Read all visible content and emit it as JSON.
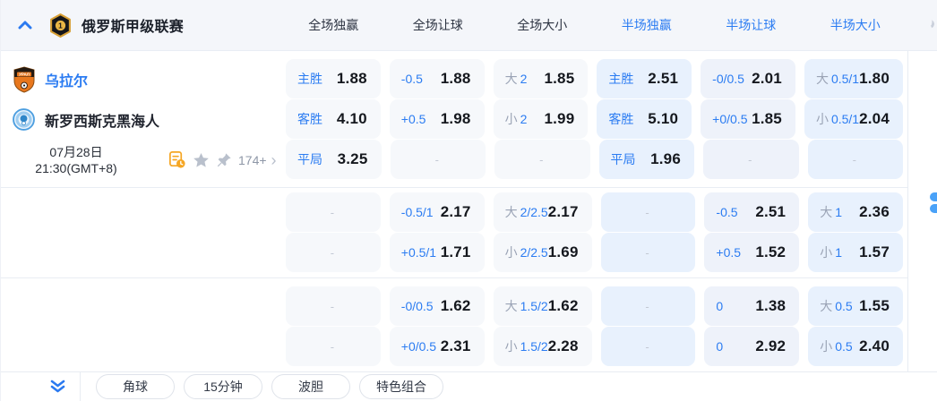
{
  "colors": {
    "accent": "#2b7cf2",
    "half_cell_bg": "#e8f1fd",
    "full_cell_bg": "#f6f8fb",
    "odds_text": "#15181e"
  },
  "header": {
    "league_title": "俄罗斯甲级联赛",
    "columns": [
      {
        "label": "全场独赢",
        "half": false
      },
      {
        "label": "全场让球",
        "half": false
      },
      {
        "label": "全场大小",
        "half": false
      },
      {
        "label": "半场独赢",
        "half": true
      },
      {
        "label": "半场让球",
        "half": true
      },
      {
        "label": "半场大小",
        "half": true
      }
    ]
  },
  "match": {
    "home_team": "乌拉尔",
    "away_team": "新罗西斯克黑海人",
    "date_line1": "07月28日",
    "date_line2": "21:30(GMT+8)",
    "markets_count": "174+",
    "more_arrow": "›"
  },
  "dash_char": "-",
  "sections": [
    {
      "rows": [
        {
          "cells": [
            {
              "label": "主胜",
              "value": "1.88"
            },
            {
              "label": "-0.5",
              "value": "1.88"
            },
            {
              "prefix": "大",
              "label": "2",
              "value": "1.85"
            },
            {
              "label": "主胜",
              "value": "2.51",
              "half": true
            },
            {
              "label": "-0/0.5",
              "value": "2.01",
              "half": true
            },
            {
              "prefix": "大",
              "label": "0.5/1",
              "value": "1.80",
              "half": true
            }
          ]
        },
        {
          "cells": [
            {
              "label": "客胜",
              "value": "4.10"
            },
            {
              "label": "+0.5",
              "value": "1.98"
            },
            {
              "prefix": "小",
              "label": "2",
              "value": "1.99"
            },
            {
              "label": "客胜",
              "value": "5.10",
              "half": true
            },
            {
              "label": "+0/0.5",
              "value": "1.85",
              "half": true
            },
            {
              "prefix": "小",
              "label": "0.5/1",
              "value": "2.04",
              "half": true
            }
          ]
        },
        {
          "cells": [
            {
              "label": "平局",
              "value": "3.25"
            },
            {
              "dash": true
            },
            {
              "dash": true
            },
            {
              "label": "平局",
              "value": "1.96",
              "half": true
            },
            {
              "dash": true,
              "half": true
            },
            {
              "dash": true,
              "half": true
            }
          ]
        }
      ]
    },
    {
      "rows": [
        {
          "cells": [
            {
              "dash": true
            },
            {
              "label": "-0.5/1",
              "value": "2.17"
            },
            {
              "prefix": "大",
              "label": "2/2.5",
              "value": "2.17"
            },
            {
              "dash": true,
              "half": true
            },
            {
              "label": "-0.5",
              "value": "2.51",
              "half": true
            },
            {
              "prefix": "大",
              "label": "1",
              "value": "2.36",
              "half": true
            }
          ]
        },
        {
          "cells": [
            {
              "dash": true
            },
            {
              "label": "+0.5/1",
              "value": "1.71"
            },
            {
              "prefix": "小",
              "label": "2/2.5",
              "value": "1.69"
            },
            {
              "dash": true,
              "half": true
            },
            {
              "label": "+0.5",
              "value": "1.52",
              "half": true
            },
            {
              "prefix": "小",
              "label": "1",
              "value": "1.57",
              "half": true
            }
          ]
        }
      ]
    },
    {
      "rows": [
        {
          "cells": [
            {
              "dash": true
            },
            {
              "label": "-0/0.5",
              "value": "1.62"
            },
            {
              "prefix": "大",
              "label": "1.5/2",
              "value": "1.62"
            },
            {
              "dash": true,
              "half": true
            },
            {
              "label": "0",
              "value": "1.38",
              "half": true
            },
            {
              "prefix": "大",
              "label": "0.5",
              "value": "1.55",
              "half": true
            }
          ]
        },
        {
          "cells": [
            {
              "dash": true
            },
            {
              "label": "+0/0.5",
              "value": "2.31"
            },
            {
              "prefix": "小",
              "label": "1.5/2",
              "value": "2.28"
            },
            {
              "dash": true,
              "half": true
            },
            {
              "label": "0",
              "value": "2.92",
              "half": true
            },
            {
              "prefix": "小",
              "label": "0.5",
              "value": "2.40",
              "half": true
            }
          ]
        }
      ]
    }
  ],
  "footer": {
    "buttons": [
      "角球",
      "15分钟",
      "波胆",
      "特色组合"
    ]
  },
  "icons": {
    "collapse": "chevron-up-icon",
    "league": "league-badge-icon",
    "stats": "match-stats-icon",
    "favorite": "star-icon",
    "pin": "pin-icon",
    "expand": "double-chevron-down-icon"
  }
}
